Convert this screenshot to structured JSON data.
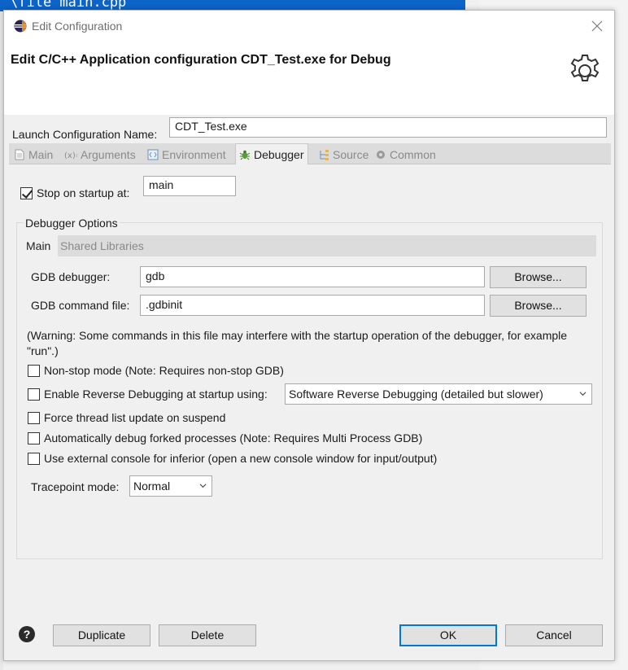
{
  "background": {
    "editor_text": "\\file main.cpp"
  },
  "window": {
    "title": "Edit Configuration",
    "heading": "Edit C/C++ Application configuration CDT_Test.exe for Debug"
  },
  "launch_config": {
    "label": "Launch Configuration Name:",
    "value": "CDT_Test.exe"
  },
  "tabs": [
    {
      "label": "Main",
      "icon": "document-icon"
    },
    {
      "label": "Arguments",
      "icon": "arguments-icon"
    },
    {
      "label": "Environment",
      "icon": "environment-icon"
    },
    {
      "label": "Debugger",
      "icon": "bug-icon",
      "active": true
    },
    {
      "label": "Source",
      "icon": "source-icon"
    },
    {
      "label": "Common",
      "icon": "common-gear-icon"
    }
  ],
  "stop_on_startup": {
    "label": "Stop on startup at:",
    "checked": true,
    "value": "main"
  },
  "debugger_options": {
    "title": "Debugger Options",
    "subtabs": [
      "Main",
      "Shared Libraries"
    ],
    "gdb_debugger": {
      "label": "GDB debugger:",
      "value": "gdb",
      "browse": "Browse..."
    },
    "gdb_command_file": {
      "label": "GDB command file:",
      "value": ".gdbinit",
      "browse": "Browse..."
    },
    "warning": "(Warning: Some commands in this file may interfere with the startup operation of the debugger, for example \"run\".)",
    "options": [
      {
        "label": "Non-stop mode (Note: Requires non-stop GDB)",
        "checked": false
      },
      {
        "label": "Enable Reverse Debugging at startup using:",
        "checked": false
      },
      {
        "label": "Force thread list update on suspend",
        "checked": false
      },
      {
        "label": "Automatically debug forked processes (Note: Requires Multi Process GDB)",
        "checked": false
      },
      {
        "label": "Use external console for inferior (open a new console window for input/output)",
        "checked": false
      }
    ],
    "reverse_mode_selected": "Software Reverse Debugging (detailed but slower)",
    "tracepoint": {
      "label": "Tracepoint mode:",
      "selected": "Normal"
    }
  },
  "footer": {
    "duplicate": "Duplicate",
    "delete": "Delete",
    "ok": "OK",
    "cancel": "Cancel",
    "help_glyph": "?"
  },
  "colors": {
    "accent": "#0078d7",
    "editor_bg": "#0c64c8"
  }
}
